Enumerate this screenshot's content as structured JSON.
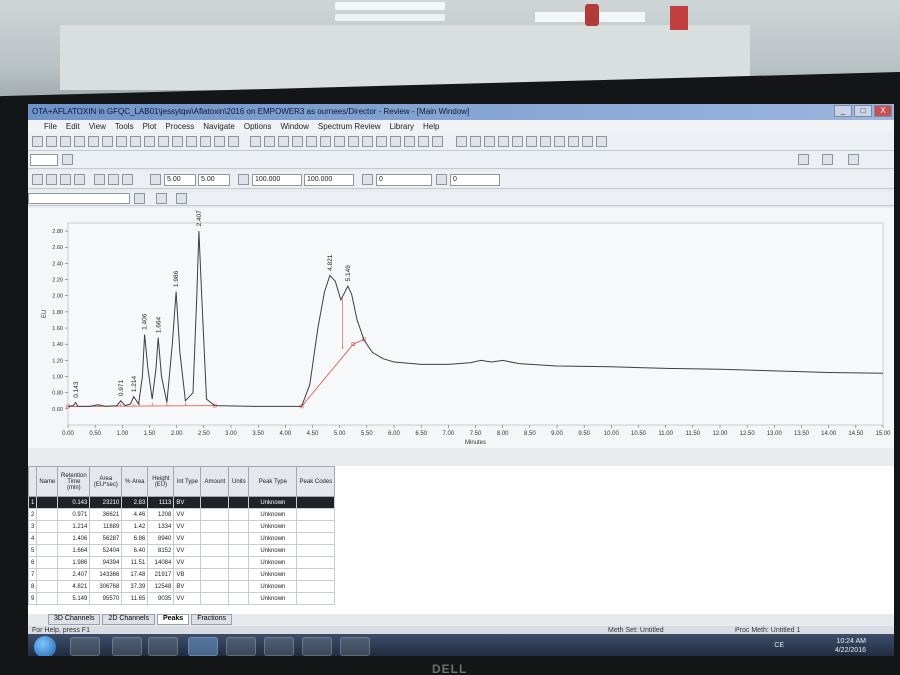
{
  "window": {
    "title": "OTA+AFLATOXIN in GFQC_LAB01\\jessytqw\\Aflatoxin\\2016 on EMPOWER3 as ournees/Director - Review - [Main Window]",
    "controls": [
      "_",
      "□",
      "X"
    ]
  },
  "menu": [
    "File",
    "Edit",
    "View",
    "Tools",
    "Plot",
    "Process",
    "Navigate",
    "Options",
    "Window",
    "Spectrum Review",
    "Library",
    "Help"
  ],
  "range_fields": {
    "x_start": "5.00",
    "x_end": "5.00",
    "y_start": "100.000",
    "y_end": "100.000",
    "a_start": "0",
    "a_end": "0"
  },
  "chart_data": {
    "type": "line",
    "xlabel": "Minutes",
    "ylabel": "EU",
    "xlim": [
      0.0,
      15.0
    ],
    "ylim": [
      0.4,
      2.9
    ],
    "x_ticks": [
      "0.00",
      "0.50",
      "1.00",
      "1.50",
      "2.00",
      "2.50",
      "3.00",
      "3.50",
      "4.00",
      "4.50",
      "5.00",
      "5.50",
      "6.00",
      "6.50",
      "7.00",
      "7.50",
      "8.00",
      "8.50",
      "9.00",
      "9.50",
      "10.00",
      "10.50",
      "11.00",
      "11.50",
      "12.00",
      "12.50",
      "13.00",
      "13.50",
      "14.00",
      "14.50",
      "15.00"
    ],
    "y_ticks": [
      "0.60",
      "0.80",
      "1.00",
      "1.20",
      "1.40",
      "1.60",
      "1.80",
      "2.00",
      "2.20",
      "2.40",
      "2.60",
      "2.80"
    ],
    "baseline": 0.63,
    "peak_labels": [
      "0.143",
      "0.971",
      "1.214",
      "1.406",
      "1.664",
      "1.986",
      "2.407",
      "4.821",
      "5.149"
    ],
    "trace": [
      [
        0.0,
        0.63
      ],
      [
        0.1,
        0.64
      ],
      [
        0.14,
        0.68
      ],
      [
        0.18,
        0.63
      ],
      [
        0.4,
        0.63
      ],
      [
        0.55,
        0.65
      ],
      [
        0.7,
        0.63
      ],
      [
        0.9,
        0.64
      ],
      [
        0.97,
        0.7
      ],
      [
        1.05,
        0.64
      ],
      [
        1.15,
        0.66
      ],
      [
        1.21,
        0.75
      ],
      [
        1.3,
        0.66
      ],
      [
        1.37,
        1.0
      ],
      [
        1.41,
        1.52
      ],
      [
        1.47,
        1.1
      ],
      [
        1.55,
        0.72
      ],
      [
        1.62,
        1.1
      ],
      [
        1.66,
        1.48
      ],
      [
        1.72,
        1.0
      ],
      [
        1.82,
        0.68
      ],
      [
        1.92,
        1.4
      ],
      [
        1.99,
        2.05
      ],
      [
        2.06,
        1.3
      ],
      [
        2.16,
        0.7
      ],
      [
        2.3,
        0.8
      ],
      [
        2.37,
        2.0
      ],
      [
        2.41,
        2.8
      ],
      [
        2.46,
        2.0
      ],
      [
        2.55,
        0.72
      ],
      [
        2.7,
        0.64
      ],
      [
        3.5,
        0.63
      ],
      [
        4.3,
        0.63
      ],
      [
        4.45,
        0.9
      ],
      [
        4.6,
        1.6
      ],
      [
        4.72,
        2.05
      ],
      [
        4.82,
        2.25
      ],
      [
        4.92,
        2.18
      ],
      [
        5.02,
        1.95
      ],
      [
        5.1,
        2.05
      ],
      [
        5.15,
        2.12
      ],
      [
        5.22,
        2.02
      ],
      [
        5.32,
        1.7
      ],
      [
        5.45,
        1.45
      ],
      [
        5.6,
        1.3
      ],
      [
        5.8,
        1.22
      ],
      [
        6.0,
        1.18
      ],
      [
        6.5,
        1.15
      ],
      [
        7.0,
        1.15
      ],
      [
        7.4,
        1.17
      ],
      [
        7.6,
        1.2
      ],
      [
        7.8,
        1.18
      ],
      [
        8.0,
        1.2
      ],
      [
        8.3,
        1.16
      ],
      [
        9.0,
        1.13
      ],
      [
        10.0,
        1.12
      ],
      [
        11.0,
        1.1
      ],
      [
        12.0,
        1.09
      ],
      [
        13.0,
        1.07
      ],
      [
        14.0,
        1.05
      ],
      [
        15.0,
        1.04
      ]
    ],
    "integration_baselines": [
      [
        [
          0.0,
          0.63
        ],
        [
          2.7,
          0.64
        ]
      ],
      [
        [
          4.3,
          0.63
        ],
        [
          5.25,
          1.4
        ]
      ],
      [
        [
          5.25,
          1.4
        ],
        [
          5.45,
          1.46
        ]
      ]
    ]
  },
  "table": {
    "columns": [
      "",
      "Name",
      "Retention Time (min)",
      "Area (EU*sec)",
      "% Area",
      "Height (EU)",
      "Int Type",
      "Amount",
      "Units",
      "Peak Type",
      "Peak Codes"
    ],
    "rows": [
      {
        "n": "1",
        "name": "",
        "rt": "0.143",
        "area": "23210",
        "pct": "2.83",
        "height": "1113",
        "int": "BV",
        "amount": "",
        "units": "",
        "ptype": "Unknown",
        "codes": ""
      },
      {
        "n": "2",
        "name": "",
        "rt": "0.971",
        "area": "36621",
        "pct": "4.46",
        "height": "1208",
        "int": "VV",
        "amount": "",
        "units": "",
        "ptype": "Unknown",
        "codes": ""
      },
      {
        "n": "3",
        "name": "",
        "rt": "1.214",
        "area": "11689",
        "pct": "1.42",
        "height": "1334",
        "int": "VV",
        "amount": "",
        "units": "",
        "ptype": "Unknown",
        "codes": ""
      },
      {
        "n": "4",
        "name": "",
        "rt": "1.406",
        "area": "56287",
        "pct": "6.86",
        "height": "8940",
        "int": "VV",
        "amount": "",
        "units": "",
        "ptype": "Unknown",
        "codes": ""
      },
      {
        "n": "5",
        "name": "",
        "rt": "1.664",
        "area": "52404",
        "pct": "6.40",
        "height": "8152",
        "int": "VV",
        "amount": "",
        "units": "",
        "ptype": "Unknown",
        "codes": ""
      },
      {
        "n": "6",
        "name": "",
        "rt": "1.986",
        "area": "94394",
        "pct": "11.51",
        "height": "14084",
        "int": "VV",
        "amount": "",
        "units": "",
        "ptype": "Unknown",
        "codes": ""
      },
      {
        "n": "7",
        "name": "",
        "rt": "2.407",
        "area": "143366",
        "pct": "17.48",
        "height": "21917",
        "int": "VB",
        "amount": "",
        "units": "",
        "ptype": "Unknown",
        "codes": ""
      },
      {
        "n": "8",
        "name": "",
        "rt": "4.821",
        "area": "306768",
        "pct": "37.39",
        "height": "12548",
        "int": "BV",
        "amount": "",
        "units": "",
        "ptype": "Unknown",
        "codes": ""
      },
      {
        "n": "9",
        "name": "",
        "rt": "5.149",
        "area": "95570",
        "pct": "11.65",
        "height": "9035",
        "int": "VV",
        "amount": "",
        "units": "",
        "ptype": "Unknown",
        "codes": ""
      }
    ]
  },
  "tabs": [
    "3D Channels",
    "2D Channels",
    "Peaks",
    "Fractions"
  ],
  "active_tab": "Peaks",
  "status": {
    "help": "For Help, press F1",
    "method_set": "Meth Set: Untitled",
    "proc_method": "Proc Meth: Untitled 1"
  },
  "taskbar": {
    "time": "10:24 AM",
    "date": "4/22/2016",
    "tray_lang": "CE"
  },
  "bezel_brand": "DELL",
  "colors": {
    "trace": "#3b3e44",
    "baseline": "#e04a3a",
    "selected_row": "#1f2226",
    "titlebar": "#6f93c9"
  }
}
